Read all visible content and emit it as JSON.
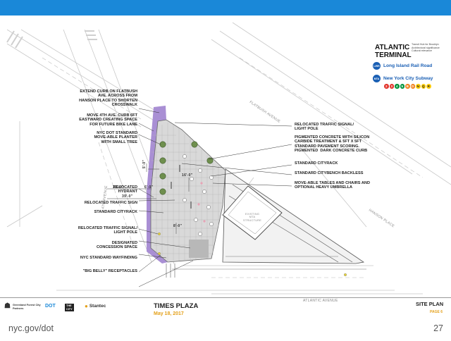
{
  "legend": {
    "title": "ATLANTIC\nTERMINAL",
    "note": "Transit Hub for Brooklyn\nArchitectural significance\nCultural relevance",
    "lirr_badge": "LIRR",
    "lirr_label": "Long Island Rail Road",
    "mta_badge": "MTA",
    "subway_label": "New York City Subway",
    "subway_lines": [
      {
        "label": "2",
        "color": "#e2342b"
      },
      {
        "label": "3",
        "color": "#e2342b"
      },
      {
        "label": "4",
        "color": "#00933c"
      },
      {
        "label": "5",
        "color": "#00933c"
      },
      {
        "label": "B",
        "color": "#f0821e"
      },
      {
        "label": "D",
        "color": "#f0821e"
      },
      {
        "label": "N",
        "color": "#fccc0a"
      },
      {
        "label": "Q",
        "color": "#fccc0a"
      },
      {
        "label": "R",
        "color": "#fccc0a"
      }
    ]
  },
  "callouts_left": [
    "EXTEND CURB ON FLATBUSH\nAVE. ACROSS FROM\nHANSON PLACE TO SHORTEN\nCROSSWALK",
    "MOVE 4TH AVE. CURB 6FT\nEASTWARD CREATING SPACE\nFOR FUTURE BIKE LANE",
    "NYC DOT STANDARD\nMOVE-ABLE PLANTER\nWITH SMALL TREE",
    "RELOCATED\nHYDRANT",
    "RELOCATED TRAFFIC SIGN",
    "STANDARD CITYRACK",
    "RELOCATED TRAFFIC SIGNAL/\nLIGHT POLE",
    "DESIGNATED\nCONCESSION SPACE",
    "NYC STANDARD WAYFINDING",
    "\"BIG BELLY\" RECEPTACLES"
  ],
  "callouts_right": [
    "RELOCATED TRAFFIC SIGNAL/\nLIGHT POLE",
    "PIGMENTED CONCRETE WITH SILICON\nCARBIDE TREATMENT & 5FT X 5FT\nSTANDARD PAVEMENT SCORING.\nPIGMENTED  DARK CONCRETE CURB",
    "STANDARD CITYRACK",
    "STANDARD CITYBENCH BACKLESS",
    "MOVE-ABLE TABLES AND CHAIRS AND\nOPTIONAL HEAVY UMBRELLA"
  ],
  "dimensions": [
    "5'-0\"",
    "39'-0\"",
    "39'-0\"",
    "6'-0\"",
    "16'-0\"",
    "8'-0\""
  ],
  "streets": {
    "flatbush": "FLATBUSH AVENUE",
    "fourth": "4TH AVENUE",
    "atlantic": "ATLANTIC AVENUE",
    "hanson": "HANSON PLACE",
    "structure": "EXISTING\nMTA\nSTRUCTURE"
  },
  "titleblock": {
    "logo1": "Greenland Forest City\nPartners",
    "logo2": "DOT",
    "logo3": "THE\nCITY",
    "logo4": "Stantec",
    "title": "TIMES PLAZA",
    "date": "May 18, 2017",
    "sheet": "SITE PLAN",
    "page": "PAGE 6"
  },
  "footer": {
    "site": "nyc.gov/dot",
    "page_number": "27"
  },
  "colors": {
    "topbar": "#1a88d8",
    "bike_space": "#a98fd4",
    "plaza_paving": "#d9d9d9",
    "accent_date": "#e4a11b"
  }
}
